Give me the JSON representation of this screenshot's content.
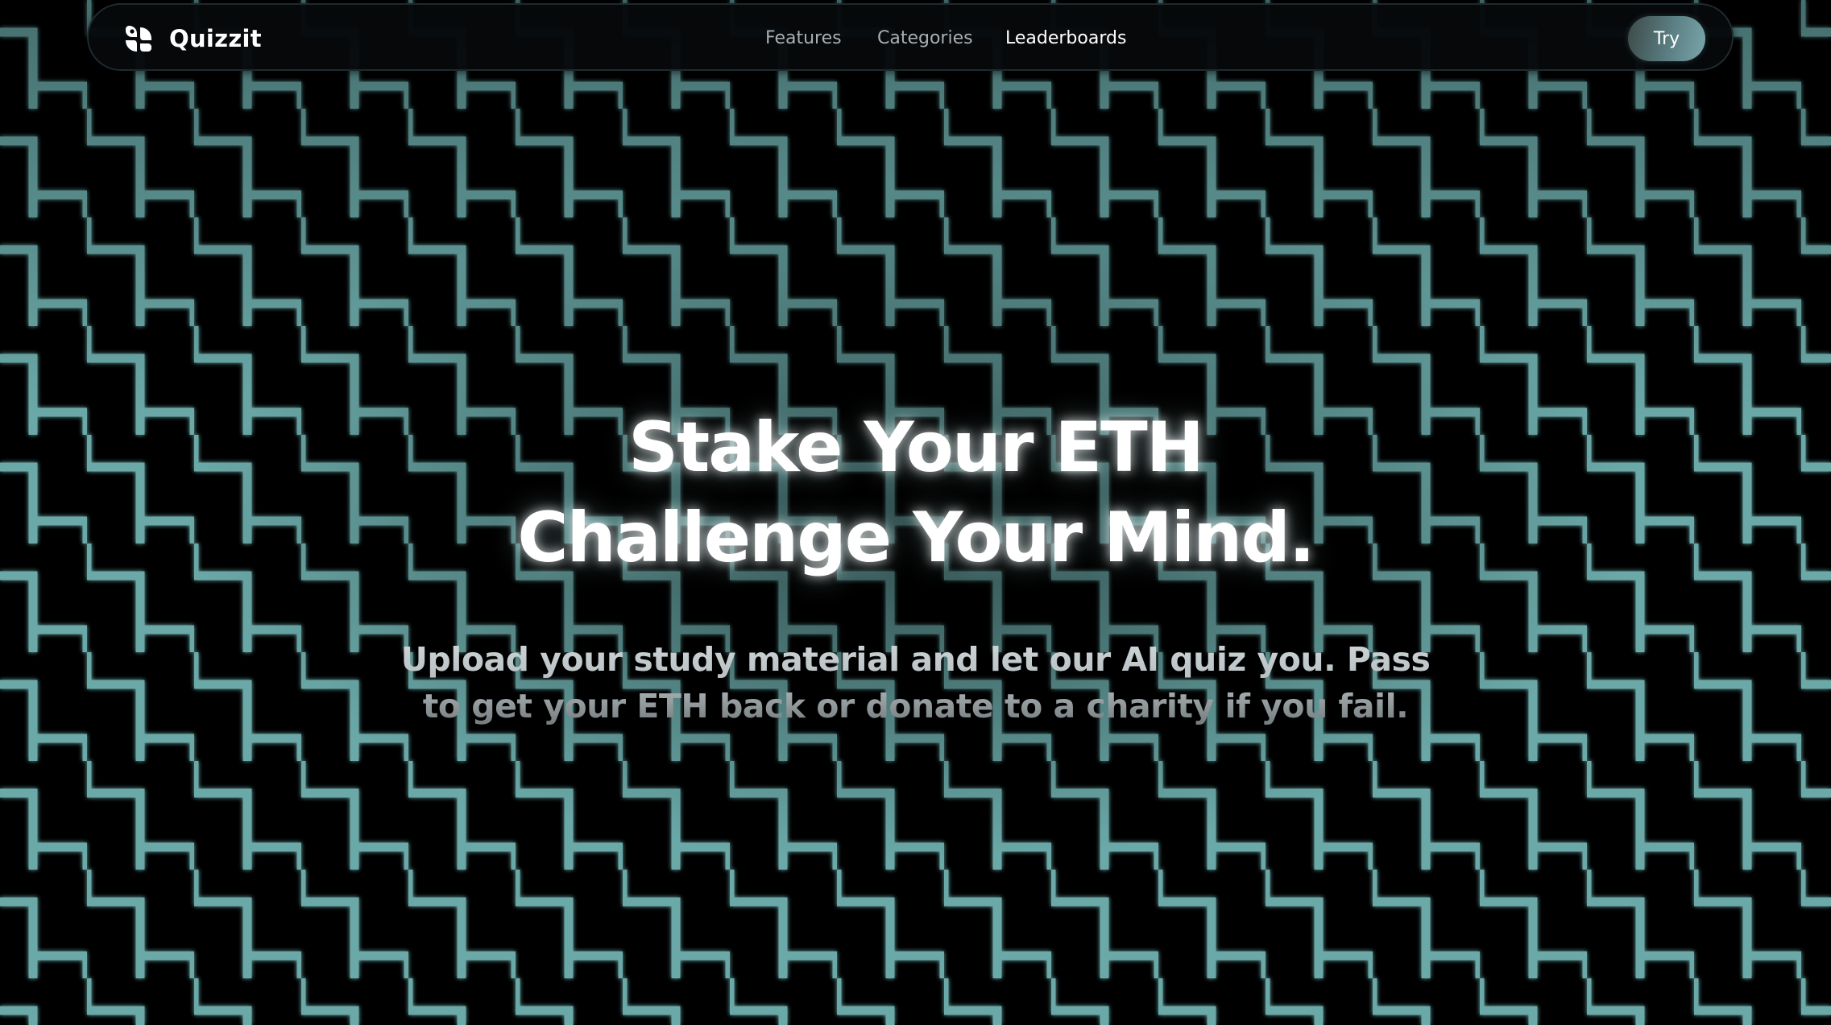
{
  "brand": {
    "name": "Quizzit",
    "icon": "quizzit-logo-icon"
  },
  "nav": {
    "links": [
      {
        "label": "Features",
        "active": false
      },
      {
        "label": "Categories",
        "active": false
      },
      {
        "label": "Leaderboards",
        "active": true
      }
    ],
    "cta_label": "Try"
  },
  "hero": {
    "title_line1": "Stake Your ETH",
    "title_line2": "Challenge Your Mind.",
    "subtitle": "Upload your study material and let our AI quiz you. Pass to get your ETH back or donate to a charity if you fail."
  },
  "theme": {
    "background": "#000000",
    "pattern_color": "#6fb3b2",
    "text_color": "#ffffff",
    "muted_nav": "#a8aeb2"
  }
}
